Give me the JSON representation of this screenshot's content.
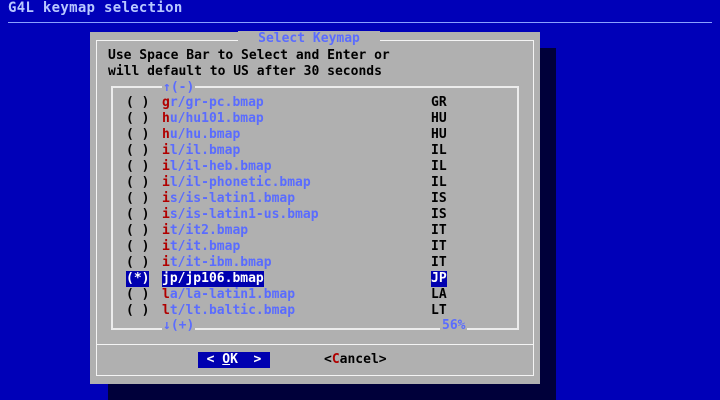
{
  "backtitle": "G4L keymap selection",
  "dialog": {
    "title": "Select Keymap",
    "prompt": "Use Space Bar to Select and Enter or\nwill default to US after 30 seconds",
    "scroll_up": "↑(-)",
    "scroll_down": "↓(+)",
    "scroll_percent": "56%",
    "items": [
      {
        "radio": "( )",
        "hotkey": "g",
        "rest": "r/gr-pc.bmap",
        "code": "GR"
      },
      {
        "radio": "( )",
        "hotkey": "h",
        "rest": "u/hu101.bmap",
        "code": "HU"
      },
      {
        "radio": "( )",
        "hotkey": "h",
        "rest": "u/hu.bmap",
        "code": "HU"
      },
      {
        "radio": "( )",
        "hotkey": "i",
        "rest": "l/il.bmap",
        "code": "IL"
      },
      {
        "radio": "( )",
        "hotkey": "i",
        "rest": "l/il-heb.bmap",
        "code": "IL"
      },
      {
        "radio": "( )",
        "hotkey": "i",
        "rest": "l/il-phonetic.bmap",
        "code": "IL"
      },
      {
        "radio": "( )",
        "hotkey": "i",
        "rest": "s/is-latin1.bmap",
        "code": "IS"
      },
      {
        "radio": "( )",
        "hotkey": "i",
        "rest": "s/is-latin1-us.bmap",
        "code": "IS"
      },
      {
        "radio": "( )",
        "hotkey": "i",
        "rest": "t/it2.bmap",
        "code": "IT"
      },
      {
        "radio": "( )",
        "hotkey": "i",
        "rest": "t/it.bmap",
        "code": "IT"
      },
      {
        "radio": "( )",
        "hotkey": "i",
        "rest": "t/it-ibm.bmap",
        "code": "IT"
      },
      {
        "radio": "(*)",
        "hotkey": "j",
        "rest": "p/jp106.bmap",
        "code": "JP"
      },
      {
        "radio": "( )",
        "hotkey": "l",
        "rest": "a/la-latin1.bmap",
        "code": "LA"
      },
      {
        "radio": "( )",
        "hotkey": "l",
        "rest": "t/lt.baltic.bmap",
        "code": "LT"
      }
    ],
    "selected_index": 11,
    "ok": {
      "left": "< ",
      "hotkey": "O",
      "rest": "K",
      "right": "  >"
    },
    "cancel": {
      "left": "<",
      "hotkey": "C",
      "rest": "ancel",
      "right": ">"
    }
  }
}
